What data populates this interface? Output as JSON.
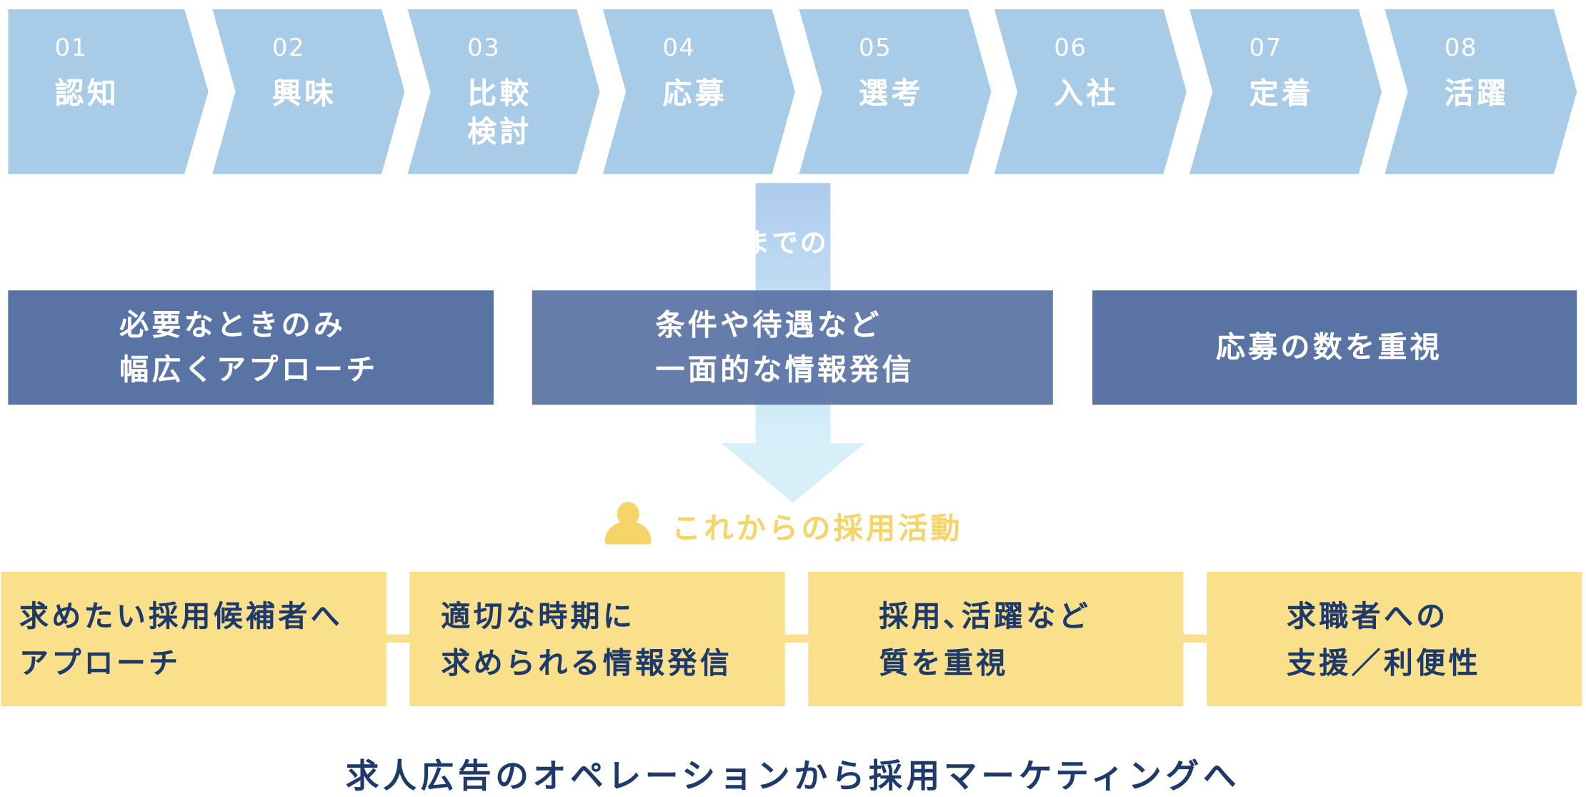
{
  "steps": [
    {
      "num": "01",
      "label": "認知"
    },
    {
      "num": "02",
      "label": "興味"
    },
    {
      "num": "03",
      "label": "比較\n検討"
    },
    {
      "num": "04",
      "label": "応募"
    },
    {
      "num": "05",
      "label": "選考"
    },
    {
      "num": "06",
      "label": "入社"
    },
    {
      "num": "07",
      "label": "定着"
    },
    {
      "num": "08",
      "label": "活躍"
    }
  ],
  "current": {
    "caption": "までの",
    "boxes": [
      {
        "text": "必要なときのみ\n幅広くアプローチ"
      },
      {
        "text": "条件や待遇など\n一面的な情報発信"
      },
      {
        "text": "応募の数を重視"
      }
    ]
  },
  "future": {
    "title": "これからの採用活動",
    "icon": "person-icon",
    "boxes": [
      {
        "text": "求めたい採用候補者へ\nアプローチ"
      },
      {
        "text": "適切な時期に\n求められる情報発信"
      },
      {
        "text": "採用､活躍など\n質を重視"
      },
      {
        "text": "求職者への\n支援／利便性"
      }
    ]
  },
  "tagline": "求人広告のオペレーションから採用マーケティングへ",
  "colors": {
    "step": "#a8cbe8",
    "current_box": "#5a73a5",
    "future_box": "#fae08a",
    "future_title": "#f5d46a",
    "dark_text": "#1d3a6b",
    "arrow_top": "#aecbef",
    "arrow_bottom": "#d6eff9"
  }
}
